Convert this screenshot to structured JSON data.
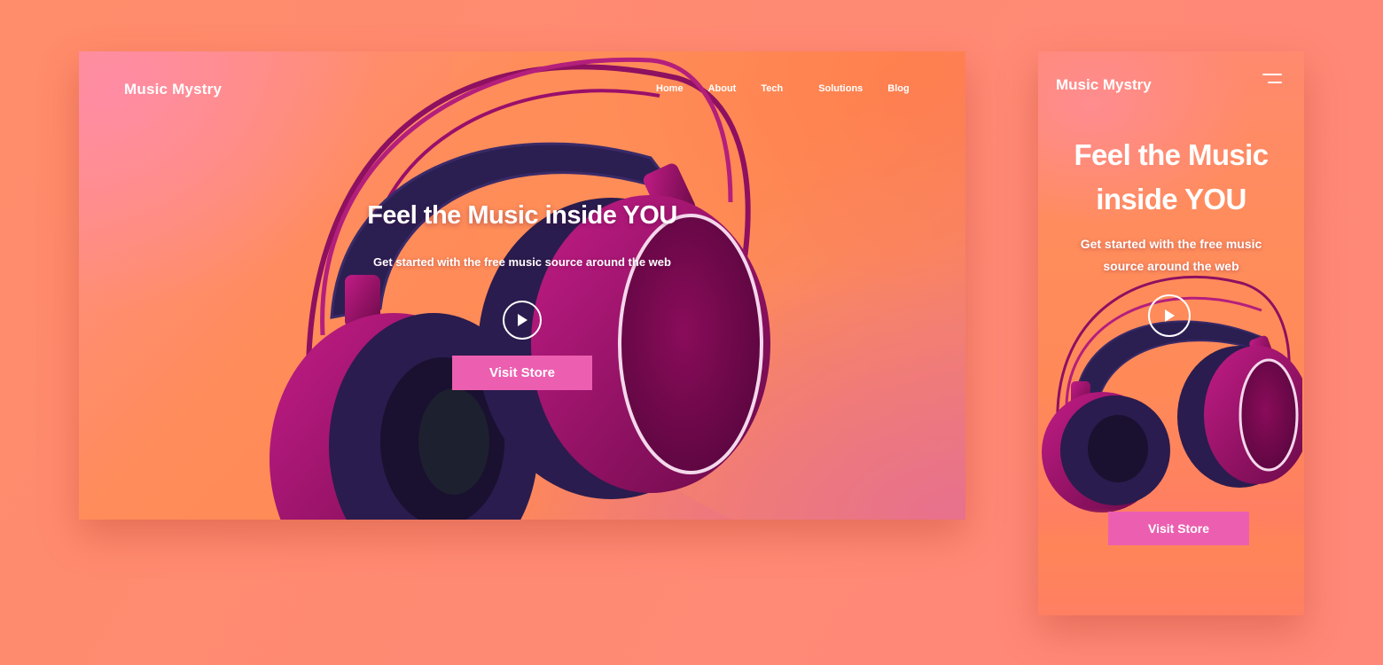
{
  "desktop": {
    "brand": "Music Mystry",
    "nav": [
      "Home",
      "About",
      "Tech",
      "Solutions",
      "Blog"
    ],
    "hero_title": "Feel the Music inside YOU",
    "hero_subtitle": "Get started with the free music source around the web",
    "cta_label": "Visit Store"
  },
  "mobile": {
    "brand": "Music Mystry",
    "hero_title_line1": "Feel the Music",
    "hero_title_line2": "inside YOU",
    "hero_subtitle": "Get started with the free music source around the web",
    "cta_label": "Visit Store"
  },
  "icons": {
    "play": "play-icon",
    "menu": "hamburger-menu-icon",
    "product": "headphones-image"
  },
  "colors": {
    "background": "#ff8a6e",
    "cta": "#ec5fb0",
    "text": "#ffffff",
    "headphone_magenta": "#a0146a",
    "headphone_cushion": "#2a1c4e"
  }
}
